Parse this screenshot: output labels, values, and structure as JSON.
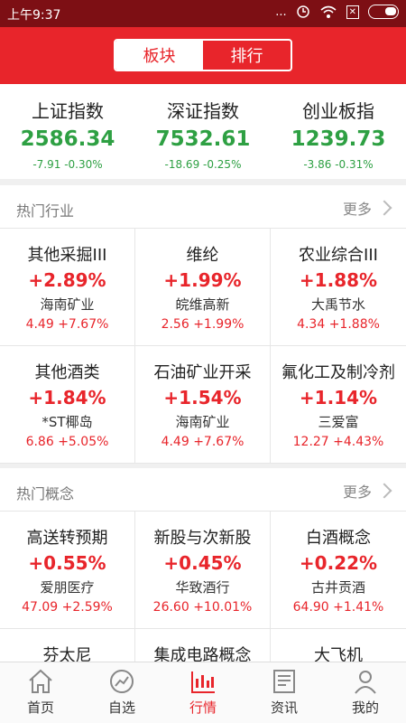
{
  "status_bar": {
    "time": "上午9:37",
    "dots": "...",
    "sim": "✕"
  },
  "header": {
    "tabs": [
      {
        "label": "板块"
      },
      {
        "label": "排行"
      }
    ]
  },
  "indices": [
    {
      "name": "上证指数",
      "value": "2586.34",
      "change": "-7.91  -0.30%"
    },
    {
      "name": "深证指数",
      "value": "7532.61",
      "change": "-18.69  -0.25%"
    },
    {
      "name": "创业板指",
      "value": "1239.73",
      "change": "-3.86  -0.31%"
    }
  ],
  "hot_industry": {
    "title": "热门行业",
    "more": "更多",
    "items": [
      {
        "name": "其他采掘III",
        "pct": "+2.89%",
        "stock": "海南矿业",
        "stats": "4.49  +7.67%"
      },
      {
        "name": "维纶",
        "pct": "+1.99%",
        "stock": "皖维高新",
        "stats": "2.56  +1.99%"
      },
      {
        "name": "农业综合III",
        "pct": "+1.88%",
        "stock": "大禹节水",
        "stats": "4.34  +1.88%"
      },
      {
        "name": "其他酒类",
        "pct": "+1.84%",
        "stock": "*ST椰岛",
        "stats": "6.86  +5.05%"
      },
      {
        "name": "石油矿业开采",
        "pct": "+1.54%",
        "stock": "海南矿业",
        "stats": "4.49  +7.67%"
      },
      {
        "name": "氟化工及制冷剂",
        "pct": "+1.14%",
        "stock": "三爱富",
        "stats": "12.27  +4.43%"
      }
    ]
  },
  "hot_concept": {
    "title": "热门概念",
    "more": "更多",
    "items": [
      {
        "name": "高送转预期",
        "pct": "+0.55%",
        "stock": "爱朋医疗",
        "stats": "47.09  +2.59%"
      },
      {
        "name": "新股与次新股",
        "pct": "+0.45%",
        "stock": "华致酒行",
        "stats": "26.60  +10.01%"
      },
      {
        "name": "白酒概念",
        "pct": "+0.22%",
        "stock": "古井贡酒",
        "stats": "64.90  +1.41%"
      },
      {
        "name": "芬太尼",
        "pct": "",
        "stock": "",
        "stats": ""
      },
      {
        "name": "集成电路概念",
        "pct": "",
        "stock": "",
        "stats": ""
      },
      {
        "name": "大飞机",
        "pct": "",
        "stock": "",
        "stats": ""
      }
    ]
  },
  "bottom_nav": [
    {
      "label": "首页",
      "icon": "home-icon"
    },
    {
      "label": "自选",
      "icon": "watchlist-chart-icon"
    },
    {
      "label": "行情",
      "icon": "candlestick-icon"
    },
    {
      "label": "资讯",
      "icon": "news-icon"
    },
    {
      "label": "我的",
      "icon": "profile-icon"
    }
  ],
  "colors": {
    "brand_red": "#e8252b",
    "status_bar": "#7d0f14",
    "down_green": "#2ea043"
  }
}
